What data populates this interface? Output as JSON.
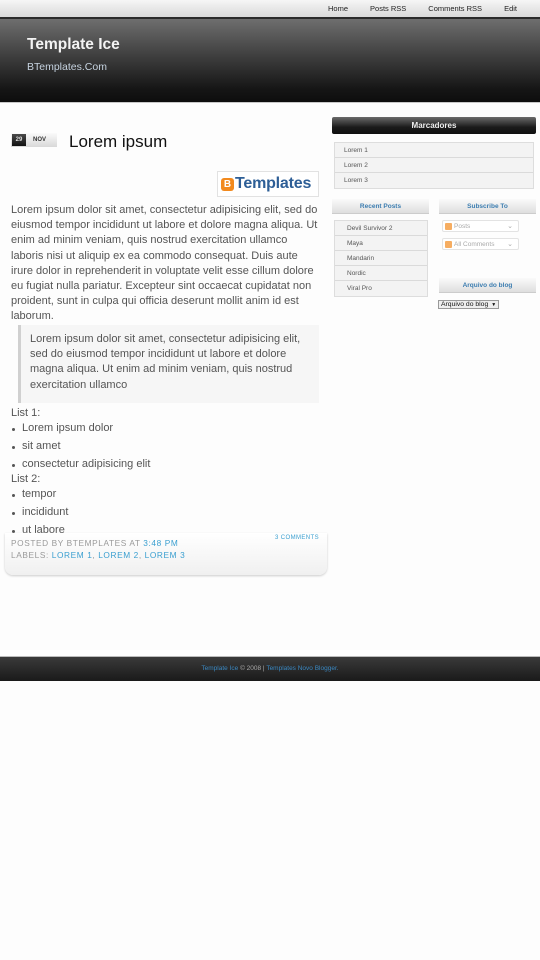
{
  "nav": {
    "items": [
      "Home",
      "Posts RSS",
      "Comments RSS",
      "Edit"
    ]
  },
  "header": {
    "title": "Template Ice",
    "description": "BTemplates.Com"
  },
  "post": {
    "date_day": "29",
    "date_month": "NOV",
    "title": "Lorem ipsum",
    "badge_letter": "B",
    "badge_text": "Templates",
    "body": "Lorem ipsum dolor sit amet, consectetur adipisicing elit, sed do eiusmod tempor incididunt ut labore et dolore magna aliqua. Ut enim ad minim veniam, quis nostrud exercitation ullamco laboris nisi ut aliquip ex ea commodo consequat. Duis aute irure dolor in reprehenderit in voluptate velit esse cillum dolore eu fugiat nulla pariatur. Excepteur sint occaecat cupidatat non proident, sunt in culpa qui officia deserunt mollit anim id est laborum.",
    "quote": "Lorem ipsum dolor sit amet, consectetur adipisicing elit, sed do eiusmod tempor incididunt ut labore et dolore magna aliqua. Ut enim ad minim veniam, quis nostrud exercitation ullamco",
    "list1_label": "List 1:",
    "list1": [
      "Lorem ipsum dolor",
      "sit amet",
      "consectetur adipisicing elit"
    ],
    "list2_label": "List 2:",
    "list2": [
      "tempor",
      "incididunt",
      "ut labore"
    ],
    "footer": {
      "posted_by": "POSTED BY BTEMPLATES AT ",
      "time": "3:48 PM",
      "labels_prefix": "LABELS: ",
      "labels": [
        "LOREM 1",
        "LOREM 2",
        "LOREM 3"
      ],
      "comments": "3 COMMENTS"
    }
  },
  "sidebar": {
    "labels_title": "Marcadores",
    "labels": [
      "Lorem 1",
      "Lorem 2",
      "Lorem 3"
    ],
    "recent_title": "Recent Posts",
    "recent": [
      "Devil Survivor 2",
      "Maya",
      "Mandarin",
      "Nordic",
      "Viral Pro"
    ],
    "subscribe_title": "Subscribe To",
    "subscribe": [
      "Posts",
      "All Comments"
    ],
    "archive_title": "Arquivo do blog",
    "archive_select": "Arquivo do blog"
  },
  "footer": {
    "link1": "Template Ice",
    "middle": " © 2008 | ",
    "link2": "Templates Novo Blogger."
  },
  "colors": {
    "accent": "#3a9fd0",
    "header_dark": "#151515",
    "badge_orange": "#f28a1e"
  }
}
